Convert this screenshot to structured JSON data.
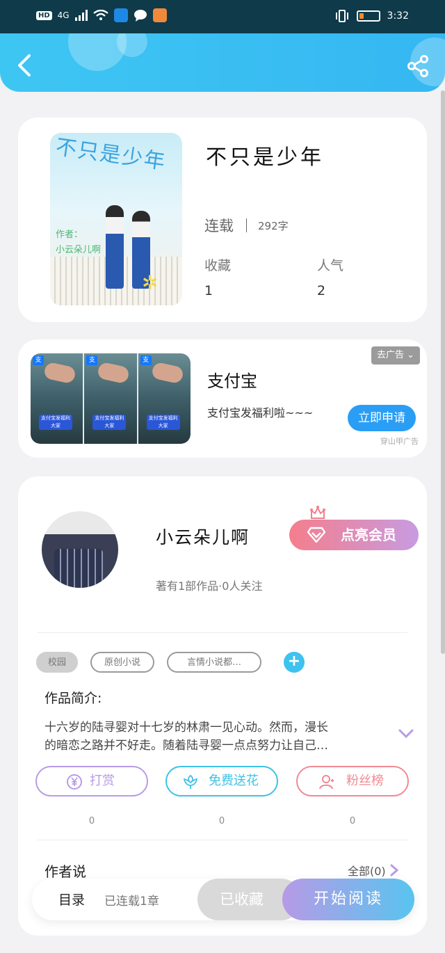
{
  "status_bar": {
    "hd": "HD",
    "network": "4G",
    "time": "3:32"
  },
  "book": {
    "title": "不只是少年",
    "status": "连载",
    "word_count": "292字",
    "collect_label": "收藏",
    "collect_value": "1",
    "popularity_label": "人气",
    "popularity_value": "2",
    "cover": {
      "title_art": "不只是少年",
      "author_line1": "作者：",
      "author_line2": "小云朵儿啊"
    }
  },
  "ad": {
    "title": "支付宝",
    "description": "支付宝发福利啦~~~",
    "button": "立即申请",
    "close": "去广告",
    "source": "穿山甲广告",
    "frame_logo": "支",
    "frame_caption": "支付宝发福利大家"
  },
  "author": {
    "name": "小云朵儿啊",
    "info": "著有1部作品·0人关注",
    "vip_button": "点亮会员"
  },
  "tags": [
    "校园",
    "原创小说",
    "言情小说都…"
  ],
  "intro": {
    "label": "作品简介:",
    "line1": "十六岁的陆寻婴对十七岁的林肃一见心动。然而，漫长",
    "line2": "的暗恋之路并不好走。随着陆寻婴一点点努力让自己…"
  },
  "actions": [
    {
      "label": "打赏",
      "count": "0",
      "color": "#b89be6",
      "icon": "yen-icon"
    },
    {
      "label": "免费送花",
      "count": "0",
      "color": "#3ec2e6",
      "icon": "flower-icon"
    },
    {
      "label": "粉丝榜",
      "count": "0",
      "color": "#f08a94",
      "icon": "fans-icon"
    }
  ],
  "author_says": {
    "label": "作者说",
    "all": "全部(0)"
  },
  "bottom_bar": {
    "catalog": "目录",
    "chapters": "已连载1章",
    "collected": "已收藏",
    "start_reading": "开始阅读"
  },
  "colors": {
    "header": "#3ec6f3",
    "accent_blue": "#2a9ef5",
    "vip_start": "#f47e8d",
    "vip_end": "#c89be0"
  }
}
